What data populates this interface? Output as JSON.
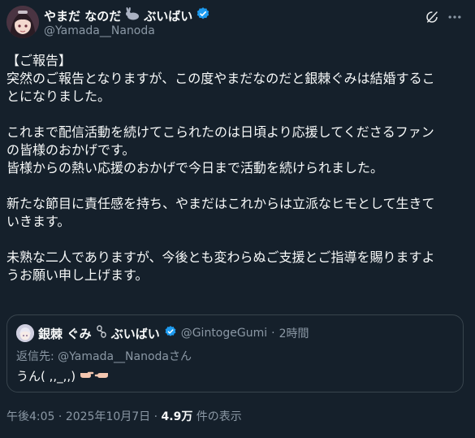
{
  "author": {
    "display_name": "やまだ なのだ",
    "suffix": "ぶいばい",
    "handle": "@Yamada__Nanoda"
  },
  "post": {
    "lines": [
      "【ご報告】",
      "突然のご報告となりますが、この度やまだなのだと銀棘ぐみは結婚するこ",
      "とになりました。",
      "",
      "これまで配信活動を続けてこられたのは日頃より応援してくださるファン",
      "の皆様のおかげです。",
      "皆様からの熱い応援のおかげで今日まで活動を続けられました。",
      "",
      "新たな節目に責任感を持ち、やまだはこれからは立派なヒモとして生きて",
      "いきます。",
      "",
      "未熟な二人でありますが、今後とも変わらぬご支援とご指導を賜りますよ",
      "うお願い申し上げます。"
    ]
  },
  "quote": {
    "display_name_a": "銀棘 ぐみ",
    "display_name_b": "ぶいばい",
    "handle": "@GintogeGumi",
    "separator": "·",
    "time": "2時間",
    "reply_prefix": "返信先: ",
    "reply_mention": "@Yamada__Nanoda",
    "reply_suffix": "さん",
    "text": "うん( ,,_,,)"
  },
  "footer": {
    "time": "午後4:05",
    "sep1": " · ",
    "date": "2025年10月7日",
    "sep2": " · ",
    "views_count": "4.9万",
    "views_label": " 件の表示"
  },
  "colors": {
    "background": "#15202b",
    "verified": "#1d9bf0",
    "muted": "#8b98a5",
    "text": "#f7f9f9",
    "border": "#38444d"
  },
  "icons": {
    "author_badge": "rabbit-icon",
    "quote_badge": "chain-icon",
    "verified": "verified-badge-icon",
    "grok": "grok-icon",
    "more": "more-icon",
    "quote_text_emoji": "pointing-fingers-icon"
  }
}
